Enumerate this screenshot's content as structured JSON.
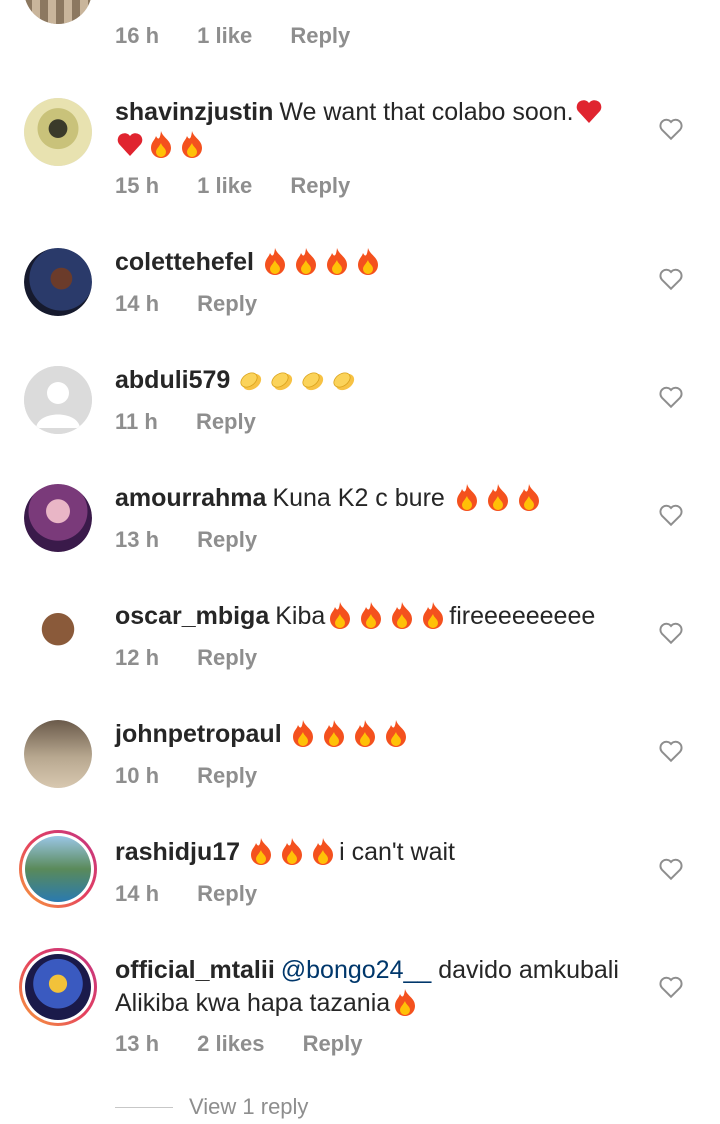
{
  "top_comment": {
    "time": "16 h",
    "likes": "1 like",
    "reply": "Reply"
  },
  "comments": [
    {
      "username": "shavinzjustin",
      "text": "We want that colabo soon.",
      "emoji_after": [
        "heart",
        "heart",
        "fire",
        "fire"
      ],
      "time": "15 h",
      "likes": "1 like",
      "reply": "Reply"
    },
    {
      "username": "colettehefel",
      "text": "",
      "emoji_after": [
        "fire",
        "fire",
        "fire",
        "fire"
      ],
      "time": "14 h",
      "likes": "",
      "reply": "Reply"
    },
    {
      "username": "abduli579",
      "text": "",
      "emoji_after": [
        "clap",
        "clap",
        "clap",
        "clap"
      ],
      "time": "11 h",
      "likes": "",
      "reply": "Reply"
    },
    {
      "username": "amourrahma",
      "text": "Kuna K2 c bure ",
      "emoji_after": [
        "fire",
        "fire",
        "fire"
      ],
      "time": "13 h",
      "likes": "",
      "reply": "Reply"
    },
    {
      "username": "oscar_mbiga",
      "text_before": "Kiba",
      "emoji_after": [
        "fire",
        "fire",
        "fire",
        "fire"
      ],
      "text_after": "fireeeeeeeee",
      "time": "12 h",
      "likes": "",
      "reply": "Reply"
    },
    {
      "username": "johnpetropaul",
      "text": "",
      "emoji_after": [
        "fire",
        "fire",
        "fire",
        "fire"
      ],
      "time": "10 h",
      "likes": "",
      "reply": "Reply"
    },
    {
      "username": "rashidju17",
      "text": "",
      "emoji_after": [
        "fire",
        "fire",
        "fire"
      ],
      "text_after": "i can't wait",
      "time": "14 h",
      "likes": "",
      "reply": "Reply"
    },
    {
      "username": "official_mtalii",
      "mention": "@bongo24__",
      "text": " davido amkubali Alikiba kwa hapa tazania",
      "emoji_after": [
        "fire"
      ],
      "time": "13 h",
      "likes": "2 likes",
      "reply": "Reply"
    }
  ],
  "view_replies": "View 1 reply",
  "colors": {
    "text": "#262626",
    "muted": "#8e8e8e",
    "mention": "#00376b"
  }
}
